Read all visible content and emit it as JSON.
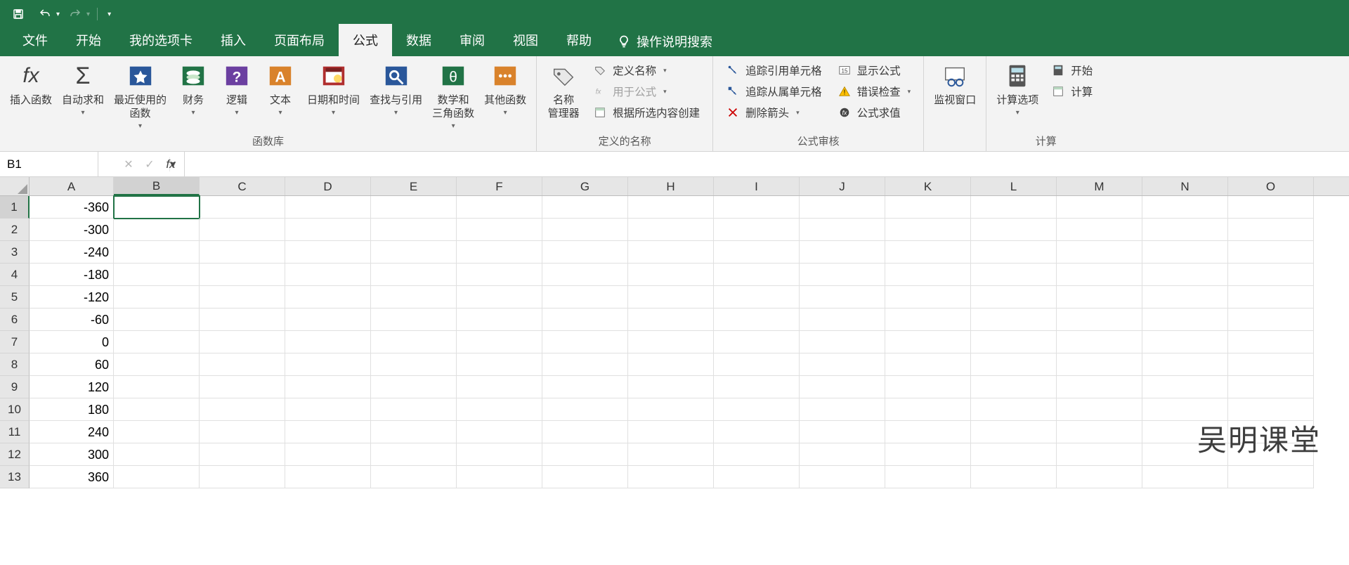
{
  "qat": {
    "save": "保存",
    "undo": "撤销",
    "redo": "恢复"
  },
  "tabs": {
    "file": "文件",
    "home": "开始",
    "custom": "我的选项卡",
    "insert": "插入",
    "layout": "页面布局",
    "formulas": "公式",
    "data": "数据",
    "review": "审阅",
    "view": "视图",
    "help": "帮助",
    "tell_me": "操作说明搜索"
  },
  "ribbon": {
    "insert_function": "插入函数",
    "autosum": "自动求和",
    "recent": "最近使用的\n函数",
    "financial": "财务",
    "logical": "逻辑",
    "text": "文本",
    "datetime": "日期和时间",
    "lookup": "查找与引用",
    "math": "数学和\n三角函数",
    "more": "其他函数",
    "group_lib": "函数库",
    "name_mgr": "名称\n管理器",
    "define_name": "定义名称",
    "use_in_formula": "用于公式",
    "create_from_sel": "根据所选内容创建",
    "group_names": "定义的名称",
    "trace_prec": "追踪引用单元格",
    "trace_dep": "追踪从属单元格",
    "remove_arrows": "删除箭头",
    "show_formulas": "显示公式",
    "error_check": "错误检查",
    "eval_formula": "公式求值",
    "group_audit": "公式审核",
    "watch_window": "监视窗口",
    "calc_options": "计算选项",
    "calc_now": "开始",
    "calc_sheet": "计算",
    "group_calc": "计算"
  },
  "fx": {
    "name_box": "B1",
    "formula": ""
  },
  "columns": [
    "A",
    "B",
    "C",
    "D",
    "E",
    "F",
    "G",
    "H",
    "I",
    "J",
    "K",
    "L",
    "M",
    "N",
    "O"
  ],
  "active_col": "B",
  "active_row": 1,
  "rows": [
    {
      "n": 1,
      "A": "-360"
    },
    {
      "n": 2,
      "A": "-300"
    },
    {
      "n": 3,
      "A": "-240"
    },
    {
      "n": 4,
      "A": "-180"
    },
    {
      "n": 5,
      "A": "-120"
    },
    {
      "n": 6,
      "A": "-60"
    },
    {
      "n": 7,
      "A": "0"
    },
    {
      "n": 8,
      "A": "60"
    },
    {
      "n": 9,
      "A": "120"
    },
    {
      "n": 10,
      "A": "180"
    },
    {
      "n": 11,
      "A": "240"
    },
    {
      "n": 12,
      "A": "300"
    },
    {
      "n": 13,
      "A": "360"
    }
  ],
  "watermark": "吴明课堂"
}
